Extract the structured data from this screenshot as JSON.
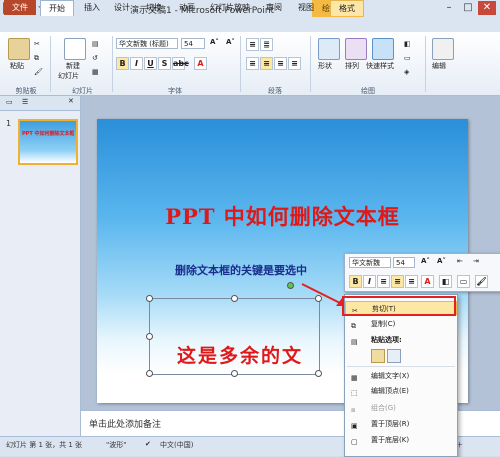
{
  "window": {
    "doc_title": "演示文稿1 - Microsoft PowerPoint",
    "context_tool": "绘图工具"
  },
  "tabs": [
    "文件",
    "开始",
    "插入",
    "设计",
    "切换",
    "动画",
    "幻灯片放映",
    "审阅",
    "视图",
    "格式"
  ],
  "ribbon": {
    "paste": "粘贴",
    "new_slide": "新建",
    "slide_label": "幻灯片",
    "font_name": "华文新魏 (标题)",
    "font_size": "54",
    "shape_btn": "形状",
    "arrange_btn": "排列",
    "quick_style_btn": "快速样式",
    "edit_btn": "编辑",
    "groups": [
      "剪贴板",
      "幻灯片",
      "字体",
      "段落",
      "绘图"
    ]
  },
  "slide": {
    "title": "PPT 中如何删除文本框",
    "subtitle": "删除文本框的关键是要选中",
    "extra_text": "这是多余的文"
  },
  "thumbnail": {
    "number": "1",
    "title": "PPT 中如何删除文本框"
  },
  "notes_placeholder": "单击此处添加备注",
  "mini_toolbar": {
    "font": "华文新魏",
    "size": "54"
  },
  "context_menu": [
    {
      "label": "剪切(T)",
      "icon": "scissors-icon"
    },
    {
      "label": "复制(C)",
      "icon": "copy-icon"
    },
    {
      "label": "粘贴选项:",
      "icon": "paste-icon"
    },
    {
      "label": "编辑文字(X)",
      "icon": "edit-text-icon"
    },
    {
      "label": "编辑顶点(E)",
      "icon": "edit-points-icon"
    },
    {
      "label": "组合(G)",
      "icon": "group-icon"
    },
    {
      "label": "置于顶层(R)",
      "icon": "bring-front-icon"
    },
    {
      "label": "置于底层(K)",
      "icon": "send-back-icon"
    }
  ],
  "status": {
    "slide_info": "幻灯片 第 1 张，共 1 张",
    "theme": "\"波形\"",
    "language": "中文(中国)"
  },
  "colors": {
    "accent_red": "#e01818",
    "highlight": "#fde7a4"
  }
}
